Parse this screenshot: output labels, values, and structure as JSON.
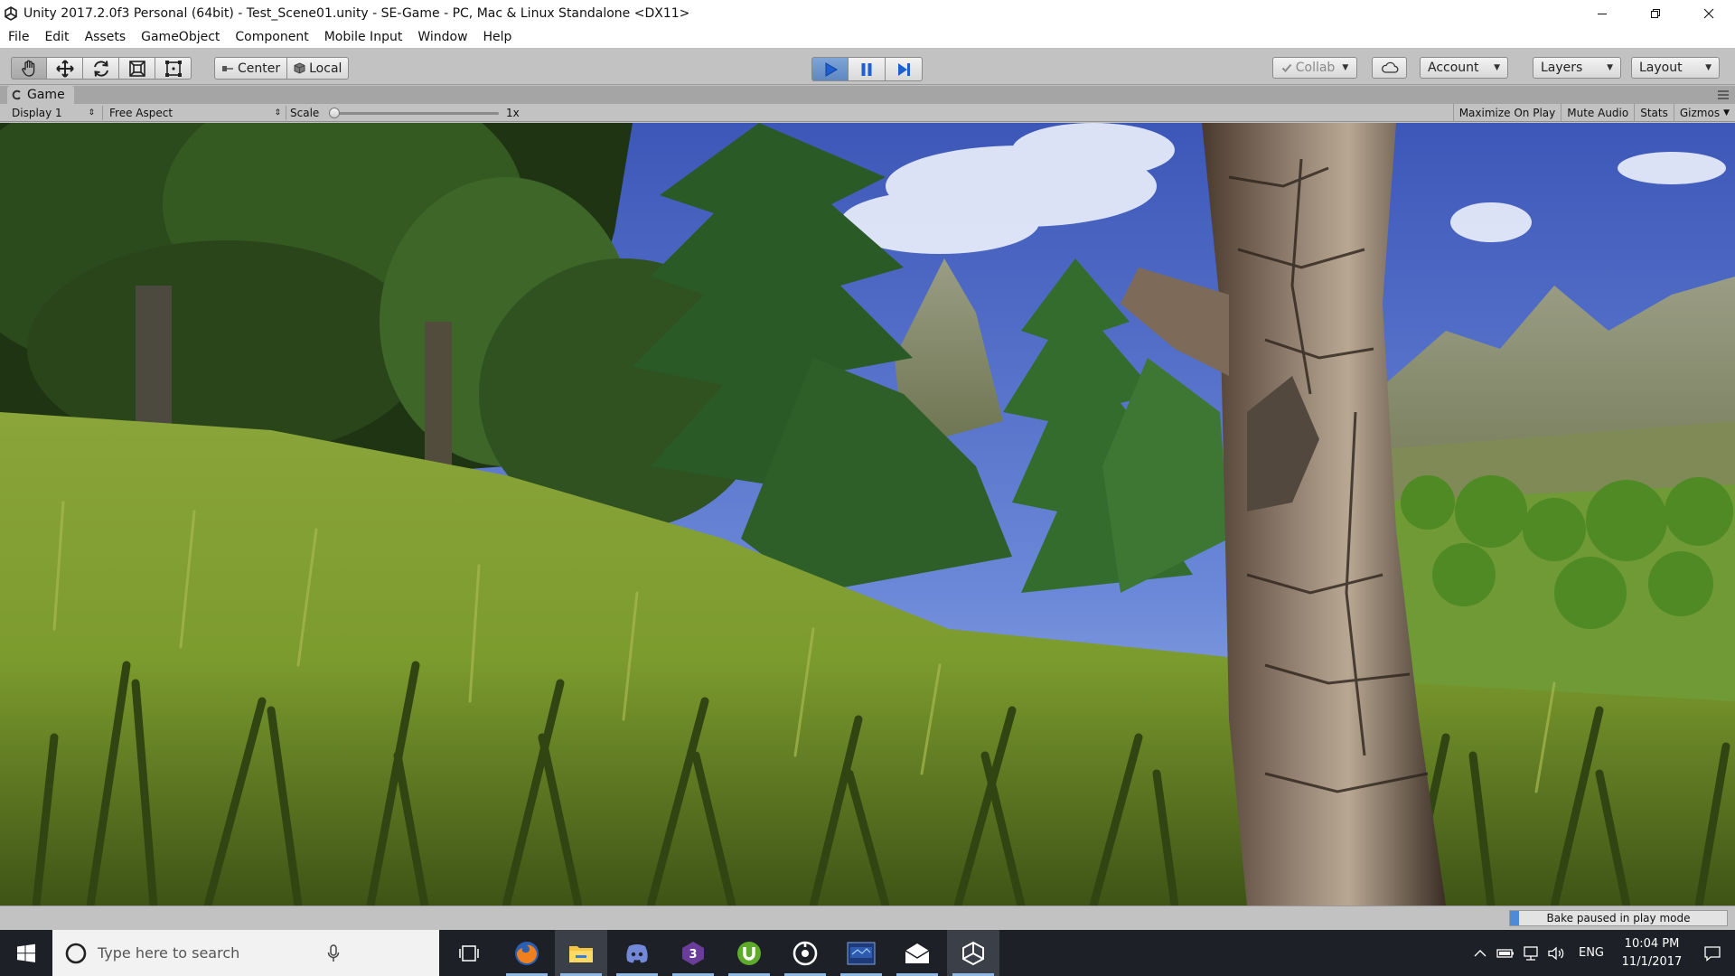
{
  "window": {
    "title": "Unity 2017.2.0f3 Personal (64bit) - Test_Scene01.unity - SE-Game - PC, Mac & Linux Standalone <DX11>"
  },
  "menu": [
    "File",
    "Edit",
    "Assets",
    "GameObject",
    "Component",
    "Mobile Input",
    "Window",
    "Help"
  ],
  "toolbar": {
    "pivot_label": "Center",
    "space_label": "Local",
    "collab_label": "Collab",
    "account_label": "Account",
    "layers_label": "Layers",
    "layout_label": "Layout"
  },
  "game_tab": {
    "title": "Game",
    "display": "Display 1",
    "aspect": "Free Aspect",
    "scale_label": "Scale",
    "scale_value": "1x",
    "scale_fraction": 0,
    "toggles": [
      "Maximize On Play",
      "Mute Audio",
      "Stats",
      "Gizmos"
    ]
  },
  "status": {
    "bake_text": "Bake paused in play mode",
    "bake_progress": 0.04
  },
  "taskbar": {
    "search_placeholder": "Type here to search",
    "language": "ENG",
    "time": "10:04 PM",
    "date": "11/1/2017",
    "apps": [
      "task-view",
      "firefox",
      "file-explorer",
      "discord",
      "visual-studio",
      "utorrent",
      "media-player",
      "monitor-app",
      "mail",
      "unity"
    ]
  },
  "colors": {
    "unity_gray": "#c2c2c2",
    "play_active": "#5f87c2",
    "taskbar": "#1d2026"
  }
}
